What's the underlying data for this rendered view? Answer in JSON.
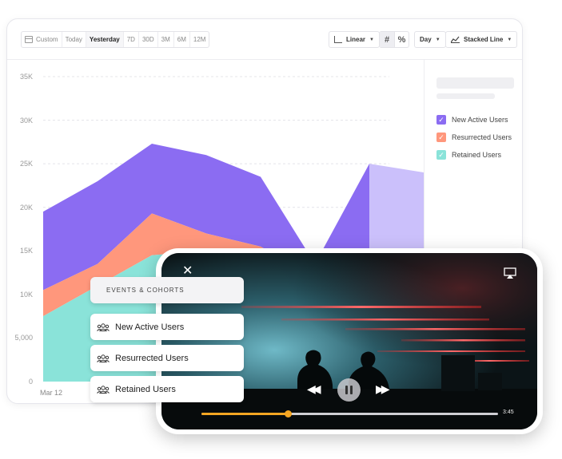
{
  "toolbar": {
    "date_ranges": [
      "Custom",
      "Today",
      "Yesterday",
      "7D",
      "30D",
      "3M",
      "6M",
      "12M"
    ],
    "active_range": "Yesterday",
    "scale_label": "Linear",
    "number_format_labels": [
      "#",
      "%"
    ],
    "interval_label": "Day",
    "chart_type_label": "Stacked Line"
  },
  "colors": {
    "new_active": "#8b6cf2",
    "new_active_projection": "#cbc0fb",
    "resurrected": "#ff977c",
    "retained": "#8ae3d9",
    "progress": "#f5a623"
  },
  "chart_data": {
    "type": "area",
    "stacked": true,
    "y_ticks": [
      "0",
      "5,000",
      "10K",
      "15K",
      "20K",
      "25K",
      "30K",
      "35K"
    ],
    "ylim": [
      0,
      35000
    ],
    "x_tick_labels": [
      "Mar 12"
    ],
    "series": [
      {
        "name": "Retained Users",
        "values": [
          7500,
          11000,
          14500,
          15000,
          12000,
          9000,
          8500,
          8500
        ]
      },
      {
        "name": "Resurrected Users",
        "values": [
          3000,
          2500,
          4800,
          2000,
          3500,
          3000,
          2500,
          2500
        ]
      },
      {
        "name": "New Active Users",
        "values": [
          9000,
          9500,
          8000,
          9000,
          8000,
          1500,
          14000,
          13000
        ]
      }
    ],
    "projected_last_point": true
  },
  "legend": {
    "items": [
      {
        "label": "New Active Users",
        "color": "#8b6cf2"
      },
      {
        "label": "Resurrected Users",
        "color": "#ff977c"
      },
      {
        "label": "Retained Users",
        "color": "#8ae3d9"
      }
    ]
  },
  "panel": {
    "title": "EVENTS & COHORTS",
    "metrics": [
      "New Active Users",
      "Resurrected Users",
      "Retained Users"
    ]
  },
  "player": {
    "duration": "3:45",
    "progress": 0.29
  }
}
